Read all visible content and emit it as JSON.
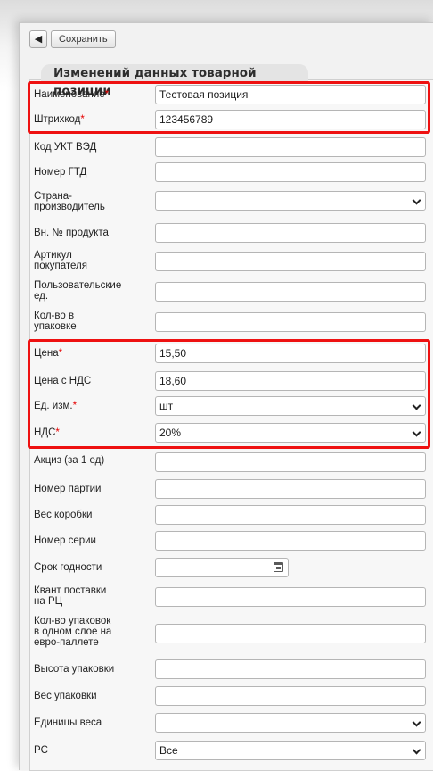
{
  "toolbar": {
    "back_icon": "chevron-left-icon",
    "save_label": "Сохранить"
  },
  "section_title": "Изменений данных товарной позиции",
  "fields": [
    {
      "label": "Наименование",
      "required": true,
      "value": "Тестовая позиция"
    },
    {
      "label": "Штрихкод",
      "required": true,
      "value": "123456789"
    },
    {
      "label": "Код УКТ ВЭД",
      "value": ""
    },
    {
      "label": "Номер ГТД",
      "value": ""
    },
    {
      "label": "Страна-\nпроизводитель",
      "value": ""
    },
    {
      "label": "Вн. № продукта",
      "value": ""
    },
    {
      "label": "Артикул\nпокупателя",
      "value": ""
    },
    {
      "label": "Пользовательские\nед.",
      "value": ""
    },
    {
      "label": "Кол-во в\nупаковке",
      "value": ""
    },
    {
      "label": "Цена",
      "required": true,
      "value": "15,50"
    },
    {
      "label": "Цена с НДС",
      "value": "18,60"
    },
    {
      "label": "Ед. изм.",
      "required": true,
      "value": "шт"
    },
    {
      "label": "НДС",
      "required": true,
      "value": "20%"
    },
    {
      "label": "Акциз (за 1 ед)",
      "value": ""
    },
    {
      "label": "Номер партии",
      "value": ""
    },
    {
      "label": "Вес коробки",
      "value": ""
    },
    {
      "label": "Номер серии",
      "value": ""
    },
    {
      "label": "Срок годности",
      "value": ""
    },
    {
      "label": "Квант поставки\nна РЦ",
      "value": ""
    },
    {
      "label": "Кол-во упаковок\nв одном слое на\nевро-паллете",
      "value": ""
    },
    {
      "label": "Высота упаковки",
      "value": ""
    },
    {
      "label": "Вес упаковки",
      "value": ""
    },
    {
      "label": "Единицы веса",
      "value": ""
    },
    {
      "label": "PC",
      "value": "Все"
    }
  ],
  "required_mark": "*",
  "colors": {
    "highlight": "#ee1111",
    "required": "#e60000"
  }
}
